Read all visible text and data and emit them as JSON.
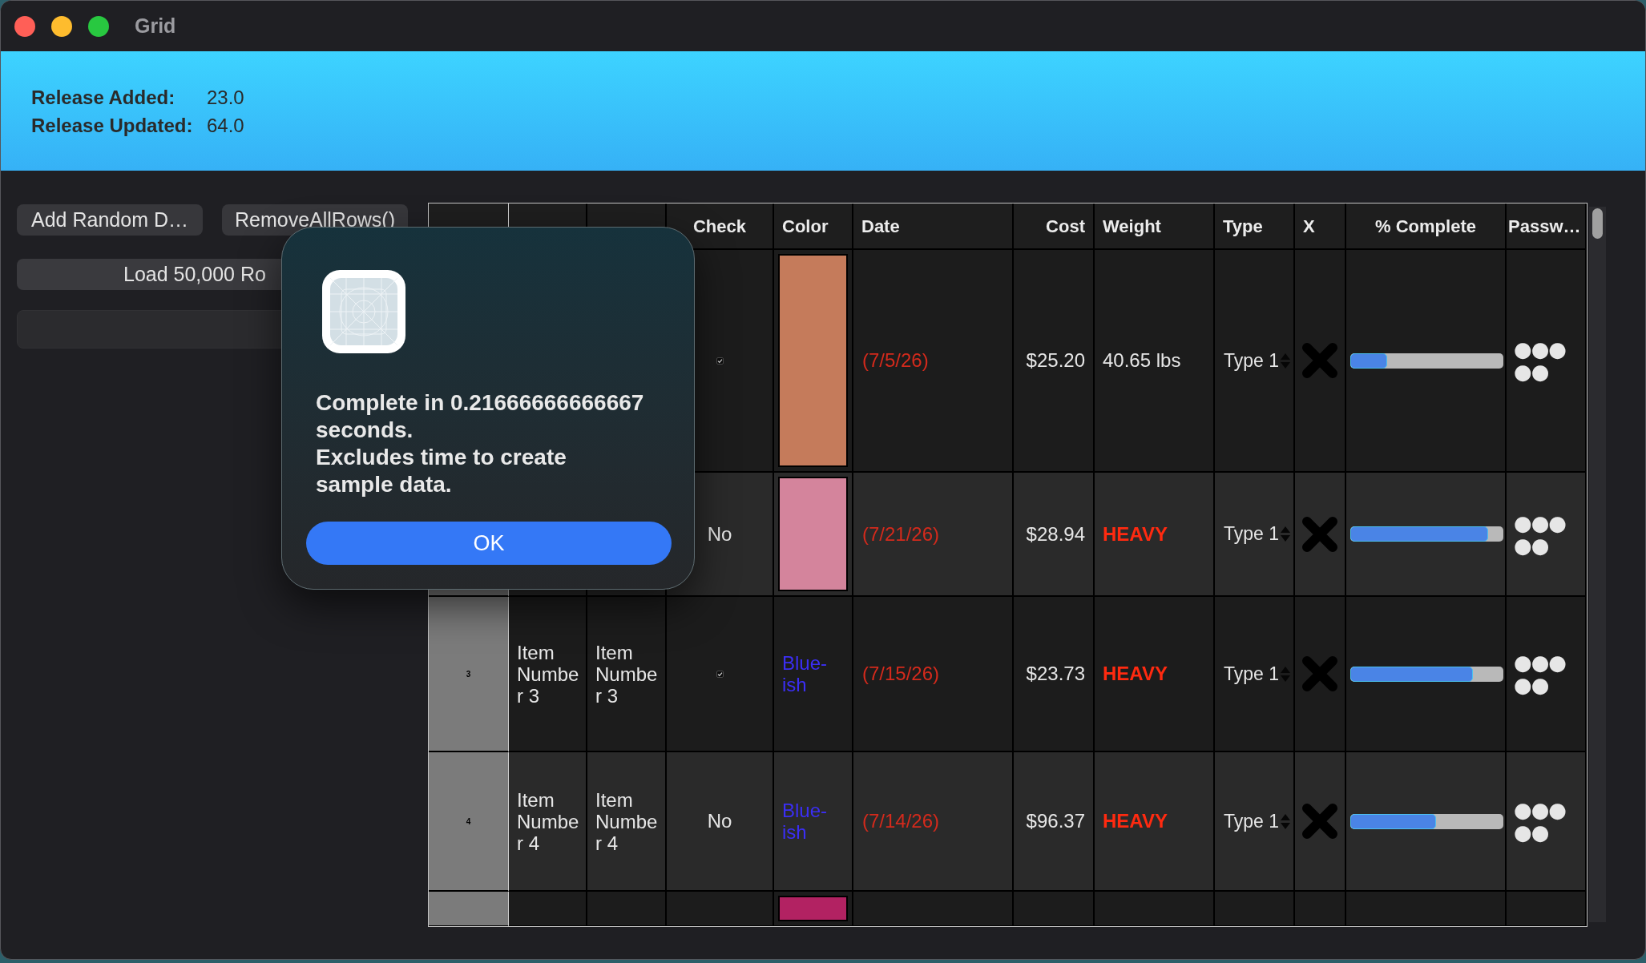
{
  "window": {
    "title": "Grid"
  },
  "header": {
    "fields": [
      {
        "label": "Release Added:",
        "value": "23.0"
      },
      {
        "label": "Release Updated:",
        "value": "64.0"
      }
    ]
  },
  "sidebar": {
    "buttons": [
      {
        "label": "Add Random D…",
        "kind": "compact"
      },
      {
        "label": "RemoveAllRows()",
        "kind": "compact"
      },
      {
        "label": "Load 50,000 Ro",
        "kind": "wide"
      }
    ]
  },
  "table": {
    "columns": [
      "Check",
      "Color",
      "Date",
      "Cost",
      "Weight",
      "Type",
      "X",
      "% Complete",
      "Passw…"
    ],
    "rows": [
      {
        "check": {
          "kind": "checkbox",
          "checked": true
        },
        "color": {
          "kind": "swatch",
          "color": "#c57b5b"
        },
        "date": "(7/5/26)",
        "cost": "$25.20",
        "weight": {
          "kind": "plain",
          "text": "40.65 lbs"
        },
        "type": "Type 1",
        "x_mark": true,
        "complete": {
          "level": 0.24
        },
        "password": "●●●●●"
      },
      {
        "check": {
          "kind": "text",
          "text": "No"
        },
        "color": {
          "kind": "swatch",
          "color": "#d4849c"
        },
        "date": "(7/21/26)",
        "cost": "$28.94",
        "weight": {
          "kind": "alert",
          "text": "HEAVY"
        },
        "type": "Type 1",
        "x_mark": true,
        "complete": {
          "level": 0.9
        },
        "password": "●●●●●"
      },
      {
        "number": "3",
        "name": "Item Number 3",
        "name_2": "Item Number 3",
        "check": {
          "kind": "checkbox",
          "checked": true
        },
        "color": {
          "kind": "text",
          "text": "Blue-ish",
          "color": "#3b2ef5"
        },
        "date": "(7/15/26)",
        "cost": "$23.73",
        "weight": {
          "kind": "alert",
          "text": "HEAVY"
        },
        "type": "Type 1",
        "x_mark": true,
        "complete": {
          "level": 0.8
        },
        "password": "●●●●●"
      },
      {
        "number": "4",
        "name": "Item Number 4",
        "name_2": "Item Number 4",
        "check": {
          "kind": "text",
          "text": "No"
        },
        "color": {
          "kind": "text",
          "text": "Blue-ish",
          "color": "#3b2ef5"
        },
        "date": "(7/14/26)",
        "cost": "$96.37",
        "weight": {
          "kind": "alert",
          "text": "HEAVY"
        },
        "type": "Type 1",
        "x_mark": true,
        "complete": {
          "level": 0.56
        },
        "password": "●●●●●"
      },
      {
        "color": {
          "kind": "swatch",
          "color": "#b22262"
        }
      }
    ]
  },
  "dialog": {
    "message": "Complete in 0.21666666666667 seconds.\nExcludes time to create sample data.",
    "button": "OK"
  }
}
